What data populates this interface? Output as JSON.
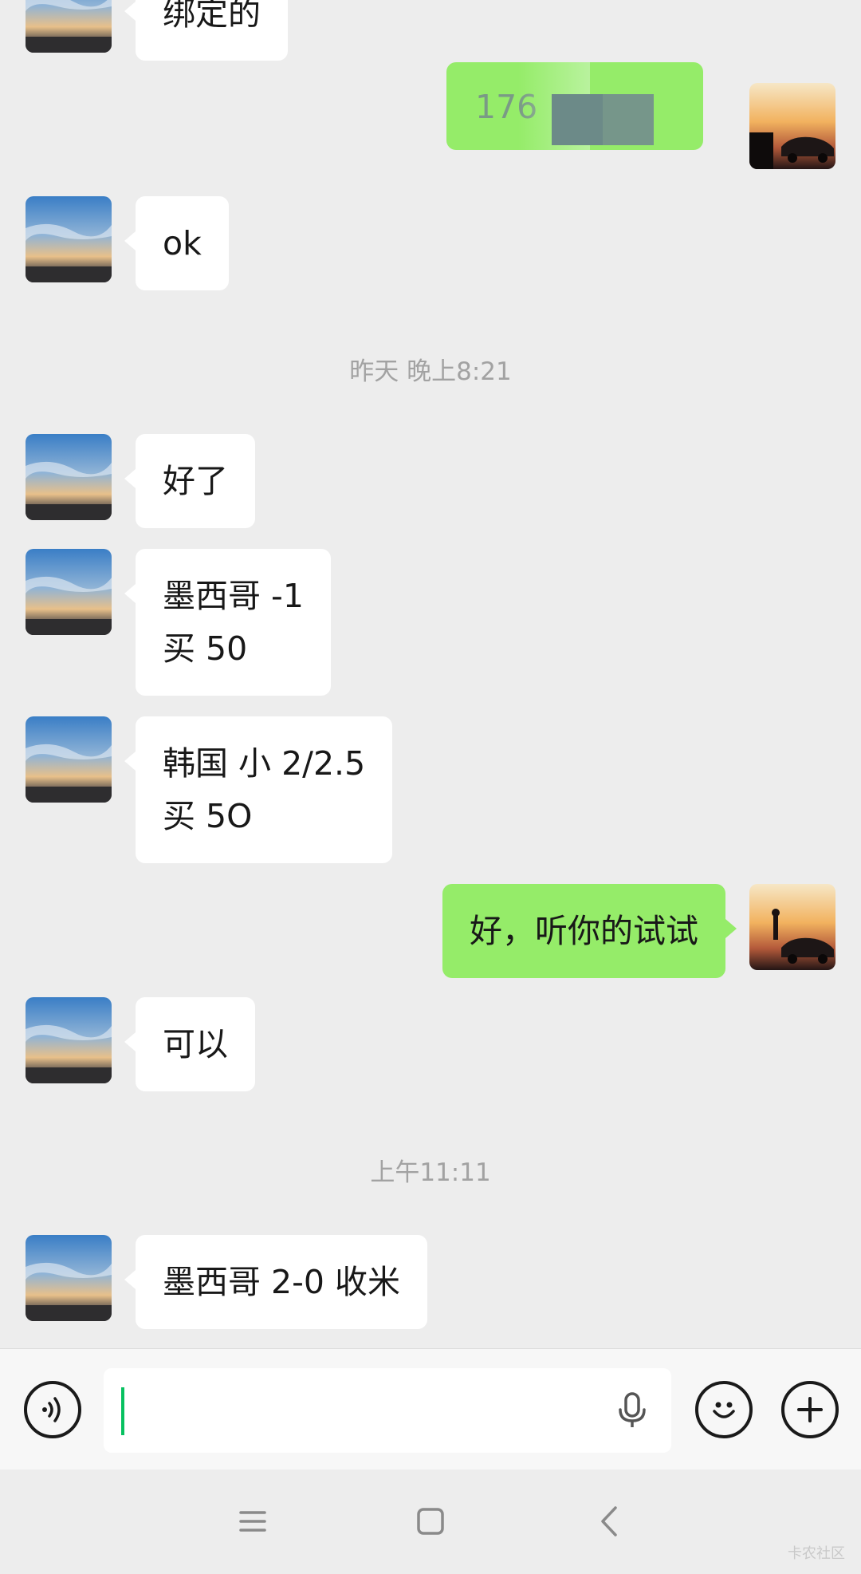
{
  "colors": {
    "background": "#ededed",
    "incoming_bubble": "#ffffff",
    "outgoing_bubble": "#95ec69",
    "timestamp_text": "#a2a2a2",
    "caret": "#07c160"
  },
  "messages": [
    {
      "side": "left",
      "text": "绑定的"
    },
    {
      "side": "right",
      "text": "176"
    },
    {
      "side": "left",
      "text": "ok"
    },
    {
      "side": "left",
      "text": "好了"
    },
    {
      "side": "left",
      "text": "墨西哥 -1\n买 50"
    },
    {
      "side": "left",
      "text": "韩国 小 2/2.5\n买 5O"
    },
    {
      "side": "right",
      "text": "好，听你的试试"
    },
    {
      "side": "left",
      "text": "可以"
    },
    {
      "side": "left",
      "text": "墨西哥 2-0 收米"
    }
  ],
  "timestamps": [
    "昨天 晚上8:21",
    "上午11:11"
  ],
  "input_bar": {
    "voice_icon": "voice-wave-icon",
    "mic_icon": "microphone-icon",
    "emoji_icon": "smiley-icon",
    "plus_icon": "plus-icon"
  },
  "nav_bar": {
    "menu_icon": "menu-icon",
    "home_icon": "square-home-icon",
    "back_icon": "chevron-left-icon"
  },
  "watermark": "卡农社区"
}
